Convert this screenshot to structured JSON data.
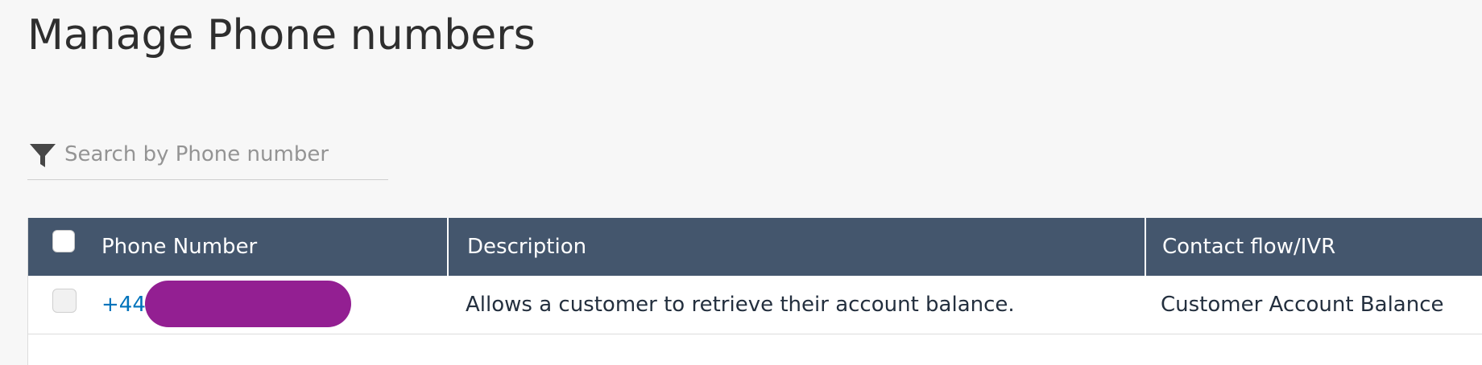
{
  "page": {
    "title": "Manage Phone numbers"
  },
  "search": {
    "placeholder": "Search by Phone number",
    "icon": "filter-icon"
  },
  "table": {
    "columns": [
      "Phone Number",
      "Description",
      "Contact flow/IVR"
    ],
    "rows": [
      {
        "phone_number": "+44",
        "description": "Allows a customer to retrieve their account balance.",
        "contact_flow": "Customer Account Balance"
      }
    ]
  },
  "colors": {
    "header_bg": "#44566d",
    "link": "#0073bb",
    "redaction": "#931f92",
    "page_bg": "#f7f7f7"
  }
}
